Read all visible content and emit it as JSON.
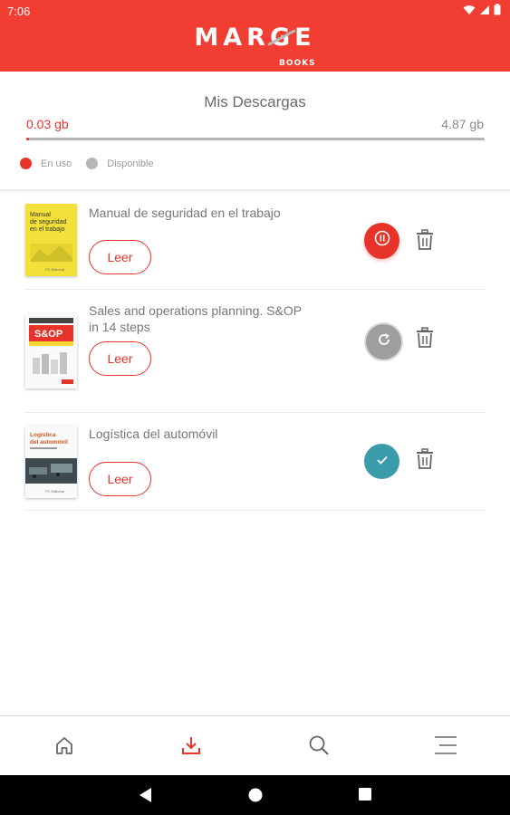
{
  "status_bar": {
    "time": "7:06",
    "icons": [
      "wifi-icon",
      "signal-icon",
      "battery-icon"
    ]
  },
  "app": {
    "logo_main": "MARGE",
    "logo_sub": "BOOKS"
  },
  "storage": {
    "title": "Mis Descargas",
    "used_label": "0.03 gb",
    "total_label": "4.87 gb",
    "used_fraction": 0.006,
    "legend": [
      {
        "label": "En uso",
        "color": "#e8332a"
      },
      {
        "label": "Disponible",
        "color": "#b5b5b5"
      }
    ]
  },
  "books": [
    {
      "title": "Manual de seguridad en el trabajo",
      "read_label": "Leer",
      "status": "downloading",
      "cover_text": "Manual de seguridad en el trabajo"
    },
    {
      "title": "Sales and operations planning. S&OP in 14 steps",
      "read_label": "Leer",
      "status": "pending",
      "cover_text": "S&OP"
    },
    {
      "title": "Logística del automóvil",
      "read_label": "Leer",
      "status": "downloaded",
      "cover_text": "Logística del automóvil"
    }
  ],
  "nav": {
    "items": [
      {
        "name": "home",
        "icon": "home-icon",
        "active": false
      },
      {
        "name": "downloads",
        "icon": "download-icon",
        "active": true
      },
      {
        "name": "search",
        "icon": "search-icon",
        "active": false
      },
      {
        "name": "menu",
        "icon": "menu-icon",
        "active": false
      }
    ]
  },
  "colors": {
    "brand": "#f23d33",
    "accent": "#e8332a",
    "complete": "#3a9bab",
    "pending": "#9e9e9e"
  }
}
